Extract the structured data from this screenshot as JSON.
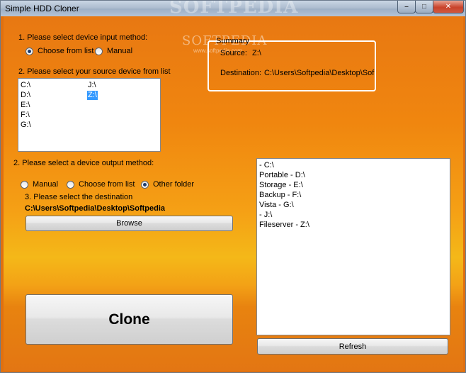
{
  "window": {
    "title": "Simple HDD Cloner",
    "watermark": "SOFTPEDIA",
    "inner_watermark": "SOFTPEDIA",
    "inner_watermark_url": "www.softpedia.com"
  },
  "input_method": {
    "heading": "1. Please select device input method:",
    "options": [
      "Choose from list",
      "Manual"
    ],
    "selected": "Choose from list"
  },
  "source_device": {
    "heading": "2. Please select your source device from list",
    "items_col1": [
      "C:\\",
      "D:\\",
      "E:\\",
      "F:\\",
      "G:\\"
    ],
    "items_col2": [
      "J:\\",
      "Z:\\"
    ],
    "selected": "Z:\\"
  },
  "summary": {
    "title": "Summary",
    "source_label": "Source:",
    "source_value": "Z:\\",
    "destination_label": "Destination:",
    "destination_value": "C:\\Users\\Softpedia\\Desktop\\Sof"
  },
  "output_method": {
    "heading": "2. Please select a device output method:",
    "options": [
      "Manual",
      "Choose from list",
      "Other folder"
    ],
    "selected": "Other folder",
    "destination_heading": "3. Please select the destination",
    "destination_path": "C:\\Users\\Softpedia\\Desktop\\Softpedia",
    "browse_label": "Browse"
  },
  "device_list": {
    "items": [
      " - C:\\",
      "Portable - D:\\",
      "Storage - E:\\",
      "Backup - F:\\",
      "Vista - G:\\",
      " - J:\\",
      "Fileserver - Z:\\"
    ]
  },
  "buttons": {
    "clone_label": "Clone",
    "refresh_label": "Refresh"
  },
  "title_buttons": {
    "minimize": "–",
    "maximize": "□",
    "close": "✕"
  }
}
